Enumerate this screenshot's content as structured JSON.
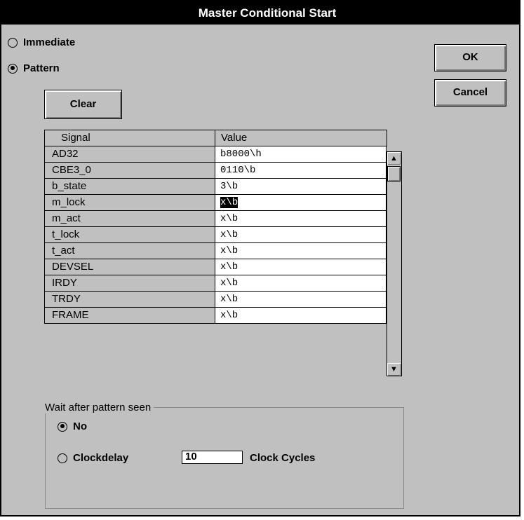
{
  "dialog": {
    "title": "Master Conditional Start",
    "mode_options": [
      {
        "label": "Immediate",
        "selected": false
      },
      {
        "label": "Pattern",
        "selected": true
      }
    ],
    "ok_label": "OK",
    "cancel_label": "Cancel",
    "clear_label": "Clear"
  },
  "table": {
    "headers": [
      "Signal",
      "Value"
    ],
    "rows": [
      {
        "signal": "AD32",
        "value": "b8000\\h"
      },
      {
        "signal": "CBE3_0",
        "value": "0110\\b"
      },
      {
        "signal": "b_state",
        "value": "3\\b"
      },
      {
        "signal": "m_lock",
        "value": "x\\b"
      },
      {
        "signal": "m_act",
        "value": "x\\b"
      },
      {
        "signal": "t_lock",
        "value": "x\\b"
      },
      {
        "signal": "t_act",
        "value": "x\\b"
      },
      {
        "signal": "DEVSEL",
        "value": "x\\b"
      },
      {
        "signal": "IRDY",
        "value": "x\\b"
      },
      {
        "signal": "TRDY",
        "value": "x\\b"
      },
      {
        "signal": "FRAME",
        "value": "x\\b"
      }
    ],
    "selected_row": "m_lock",
    "scroll_up_icon": "arrow-up-icon",
    "scroll_down_icon": "arrow-down-icon"
  },
  "wait": {
    "group_label": "Wait after pattern seen",
    "options": [
      {
        "label": "No",
        "selected": true
      },
      {
        "label": "Clockdelay",
        "selected": false
      }
    ],
    "clock_value": "10",
    "clock_unit": "Clock Cycles"
  }
}
